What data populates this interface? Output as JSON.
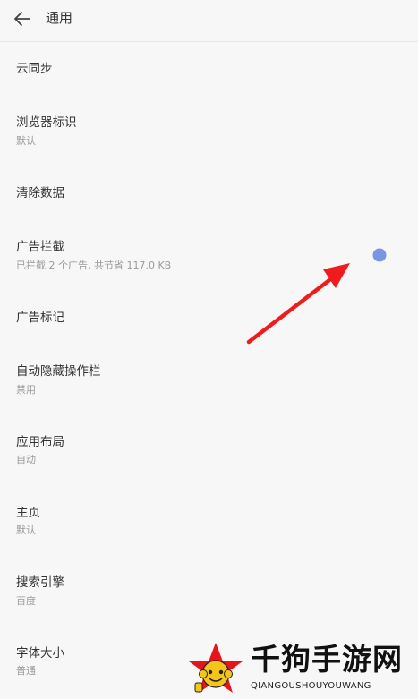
{
  "header": {
    "back_icon": "arrow-left-icon",
    "title": "通用"
  },
  "settings": {
    "items": [
      {
        "label": "云同步",
        "sub": ""
      },
      {
        "label": "浏览器标识",
        "sub": "默认"
      },
      {
        "label": "清除数据",
        "sub": ""
      },
      {
        "label": "广告拦截",
        "sub": "已拦截 2 个广告, 共节省 117.0 KB"
      },
      {
        "label": "广告标记",
        "sub": ""
      },
      {
        "label": "自动隐藏操作栏",
        "sub": "禁用"
      },
      {
        "label": "应用布局",
        "sub": "自动"
      },
      {
        "label": "主页",
        "sub": "默认"
      },
      {
        "label": "搜索引擎",
        "sub": "百度"
      },
      {
        "label": "字体大小",
        "sub": "普通"
      }
    ]
  },
  "annotation": {
    "arrow_color": "#ee1c1c",
    "dot_color": "#7b95e3"
  },
  "watermark": {
    "text": "千狗手游网",
    "subtext": "QIANGOUSHOUYOUWANG",
    "star_color": "#e8141c"
  }
}
